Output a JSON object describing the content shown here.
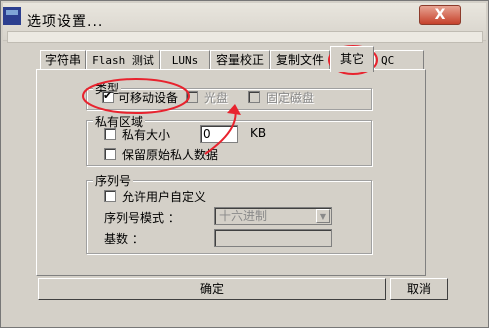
{
  "window": {
    "title": "选项设置...",
    "close_label": "X"
  },
  "tabs": [
    {
      "label": "字符串",
      "active": false
    },
    {
      "label": "Flash 测试",
      "active": false
    },
    {
      "label": "LUNs",
      "active": false
    },
    {
      "label": "容量校正",
      "active": false
    },
    {
      "label": "复制文件",
      "active": false
    },
    {
      "label": "其它",
      "active": true
    },
    {
      "label": "QC",
      "active": false
    }
  ],
  "type_group": {
    "title": "类型",
    "removable": {
      "label": "可移动设备",
      "checked": true
    },
    "cdrom": {
      "label": "光盘",
      "checked": false,
      "enabled": false
    },
    "fixed_disk": {
      "label": "固定磁盘",
      "checked": false,
      "enabled": false
    }
  },
  "private_group": {
    "title": "私有区域",
    "size": {
      "label": "私有大小",
      "checked": false,
      "value": "0",
      "unit": "KB"
    },
    "keep_data": {
      "label": "保留原始私人数据",
      "checked": false
    }
  },
  "serial_group": {
    "title": "序列号",
    "allow_custom": {
      "label": "允许用户自定义",
      "checked": false
    },
    "mode_label": "序列号模式 ：",
    "mode_value": "十六进制",
    "base_label": "基数 ：",
    "base_value": ""
  },
  "buttons": {
    "ok": "确定",
    "cancel": "取消"
  },
  "annotation_color": "#e8232e"
}
